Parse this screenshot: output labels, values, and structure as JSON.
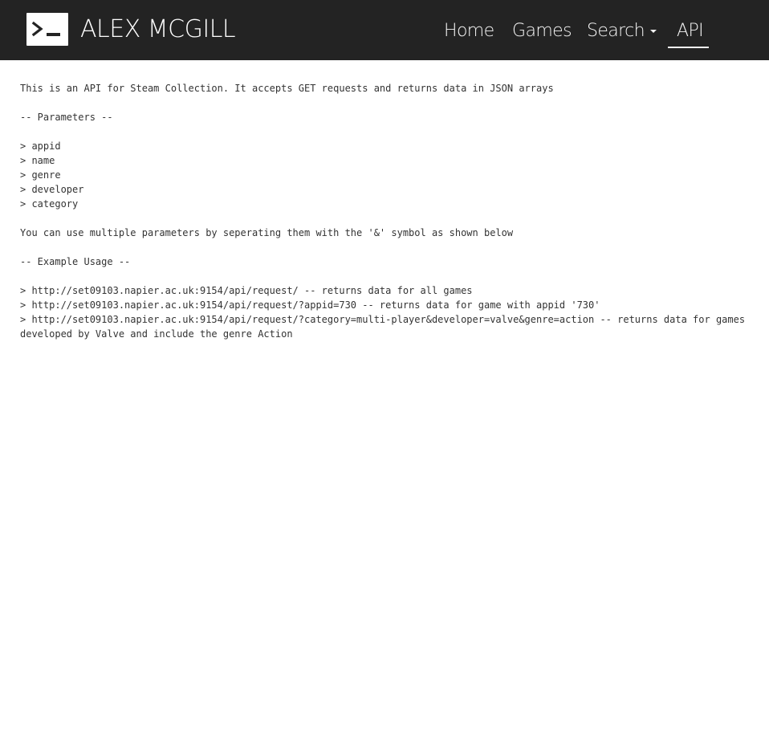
{
  "header": {
    "brand": "ALEX MCGILL",
    "logo_icon": "terminal-icon",
    "nav": {
      "home": "Home",
      "games": "Games",
      "search": "Search",
      "api": "API",
      "active": "API"
    }
  },
  "content": {
    "intro": "This is an API for Steam Collection. It accepts GET requests and returns data in JSON arrays",
    "params_heading": "-- Parameters --",
    "params": [
      "> appid",
      "> name",
      "> genre",
      "> developer",
      "> category"
    ],
    "multi_note": "You can use multiple parameters by seperating them with the '&' symbol as shown below",
    "example_heading": "-- Example Usage --",
    "examples": [
      "> http://set09103.napier.ac.uk:9154/api/request/ -- returns data for all games",
      "> http://set09103.napier.ac.uk:9154/api/request/?appid=730 -- returns data for game with appid '730'",
      "> http://set09103.napier.ac.uk:9154/api/request/?category=multi-player&developer=valve&genre=action -- returns data for games developed by Valve and include the genre Action"
    ]
  },
  "colors": {
    "navbar_bg": "#232323",
    "nav_text": "#f5f5f5",
    "body_text": "#333333",
    "page_bg": "#ffffff"
  }
}
